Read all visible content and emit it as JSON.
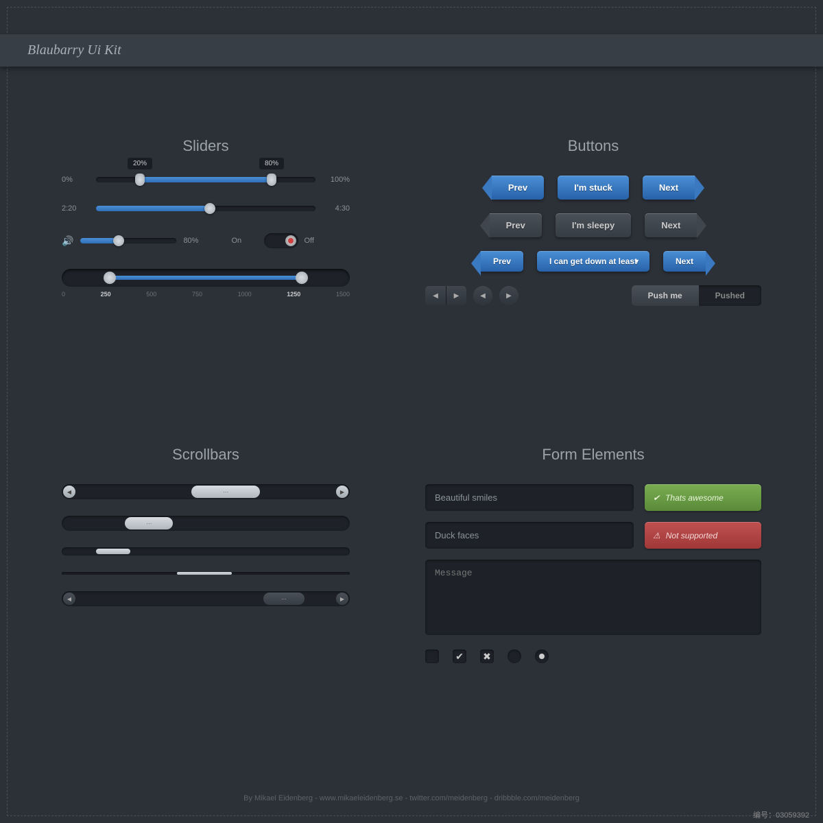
{
  "title": "Blaubarry Ui Kit",
  "sliders": {
    "heading": "Sliders",
    "range1": {
      "min_label": "0%",
      "max_label": "100%",
      "low_tooltip": "20%",
      "high_tooltip": "80%",
      "low_pct": 20,
      "high_pct": 80
    },
    "progress": {
      "start_label": "2:20",
      "end_label": "4:30",
      "pct": 52
    },
    "volume": {
      "pct": 40,
      "value_label": "80%"
    },
    "toggle": {
      "on_label": "On",
      "off_label": "Off"
    },
    "scale": {
      "low": 250,
      "high": 1250,
      "ticks": [
        "0",
        "250",
        "500",
        "750",
        "1000",
        "1250",
        "1500"
      ]
    }
  },
  "buttons": {
    "heading": "Buttons",
    "row1": {
      "prev": "Prev",
      "mid": "I'm stuck",
      "next": "Next"
    },
    "row2": {
      "prev": "Prev",
      "mid": "I'm sleepy",
      "next": "Next"
    },
    "row3": {
      "prev": "Prev",
      "dropdown": "I can get down at least",
      "next": "Next"
    },
    "toggle": {
      "push": "Push me",
      "pushed": "Pushed"
    }
  },
  "scrollbars": {
    "heading": "Scrollbars"
  },
  "forms": {
    "heading": "Form Elements",
    "input1": "Beautiful smiles",
    "status1": "Thats awesome",
    "input2": "Duck faces",
    "status2": "Not supported",
    "textarea": "Message"
  },
  "footer": "By Mikael Eidenberg - www.mikaeleidenberg.se - twitter.com/meidenberg - dribbble.com/meidenberg",
  "meta": {
    "id_label": "编号：",
    "id": "03059392"
  }
}
